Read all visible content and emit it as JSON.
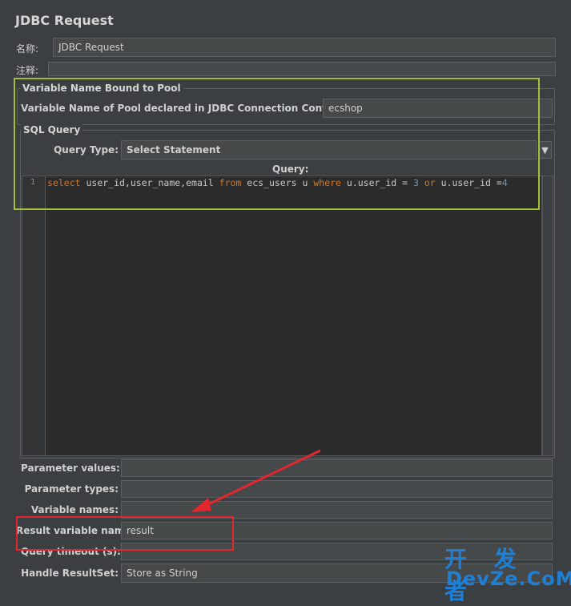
{
  "panel": {
    "title": "JDBC Request"
  },
  "name_row": {
    "label": "名称:",
    "value": "JDBC Request"
  },
  "comment_row": {
    "label": "注释:",
    "value": ""
  },
  "pool_group": {
    "legend": "Variable Name Bound to Pool",
    "pool_label": "Variable Name of Pool declared in JDBC Connection Configuration:",
    "pool_value": "ecshop"
  },
  "sql_group": {
    "legend": "SQL Query",
    "query_type_label": "Query Type:",
    "query_type_value": "Select Statement",
    "dropdown_arrow": "▼",
    "query_label": "Query:"
  },
  "editor": {
    "line_number": "1",
    "code_segments": {
      "kw_select": "select",
      "s1": " user_id,user_name,email ",
      "kw_from": "from",
      "s2": " ecs_users u ",
      "kw_where": "where",
      "s3": " u.user_id = ",
      "n1": "3",
      "s4": " ",
      "kw_or": "or",
      "s5": " u.user_id =",
      "n2": "4"
    }
  },
  "params": {
    "values_label": "Parameter values:",
    "values_value": "",
    "types_label": "Parameter types:",
    "types_value": "",
    "varnames_label": "Variable names:",
    "varnames_value": "",
    "result_label": "Result variable name:",
    "result_value": "result",
    "timeout_label": "Query timeout (s):",
    "timeout_value": "",
    "handle_label": "Handle ResultSet:",
    "handle_value": "Store as String"
  },
  "watermark": {
    "top": "开 发 者",
    "bottom": "DevZe.CoM"
  },
  "colors": {
    "green_highlight": "#a2c13a",
    "red_highlight": "#e3262e",
    "watermark": "#1e7fd6"
  }
}
